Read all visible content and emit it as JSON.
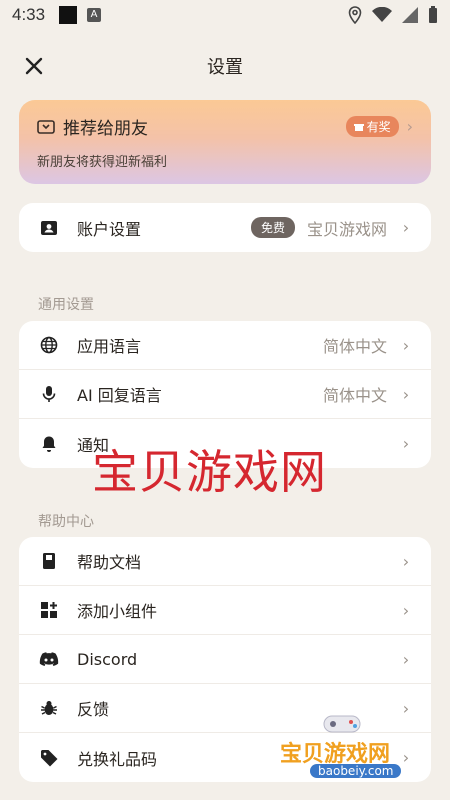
{
  "status_bar": {
    "time": "4:33"
  },
  "header": {
    "title": "设置"
  },
  "promo": {
    "title": "推荐给朋友",
    "badge": "有奖",
    "subtitle": "新朋友将获得迎新福利",
    "gradient_colors": [
      "#fbc995",
      "#dcc6e4"
    ]
  },
  "account": {
    "label": "账户设置",
    "badge": "免费",
    "value": "宝贝游戏网",
    "icon": "account-icon"
  },
  "general": {
    "section_title": "通用设置",
    "items": [
      {
        "label": "应用语言",
        "value": "简体中文",
        "icon": "globe-icon"
      },
      {
        "label": "AI 回复语言",
        "value": "简体中文",
        "icon": "mic-icon"
      },
      {
        "label": "通知",
        "value": "",
        "icon": "bell-icon"
      }
    ]
  },
  "help": {
    "section_title": "帮助中心",
    "items": [
      {
        "label": "帮助文档",
        "icon": "book-icon"
      },
      {
        "label": "添加小组件",
        "icon": "widget-icon"
      },
      {
        "label": "Discord",
        "icon": "discord-icon"
      },
      {
        "label": "反馈",
        "icon": "bug-icon"
      },
      {
        "label": "兑换礼品码",
        "icon": "tag-icon"
      }
    ]
  },
  "watermark": {
    "text": "宝贝游戏网",
    "logo_text": "宝贝游戏网",
    "logo_url": "baobeiy.com"
  },
  "colors": {
    "background": "#f3efe9",
    "card": "#ffffff",
    "watermark_red": "#d5272f",
    "badge_orange": "#e8865c"
  }
}
